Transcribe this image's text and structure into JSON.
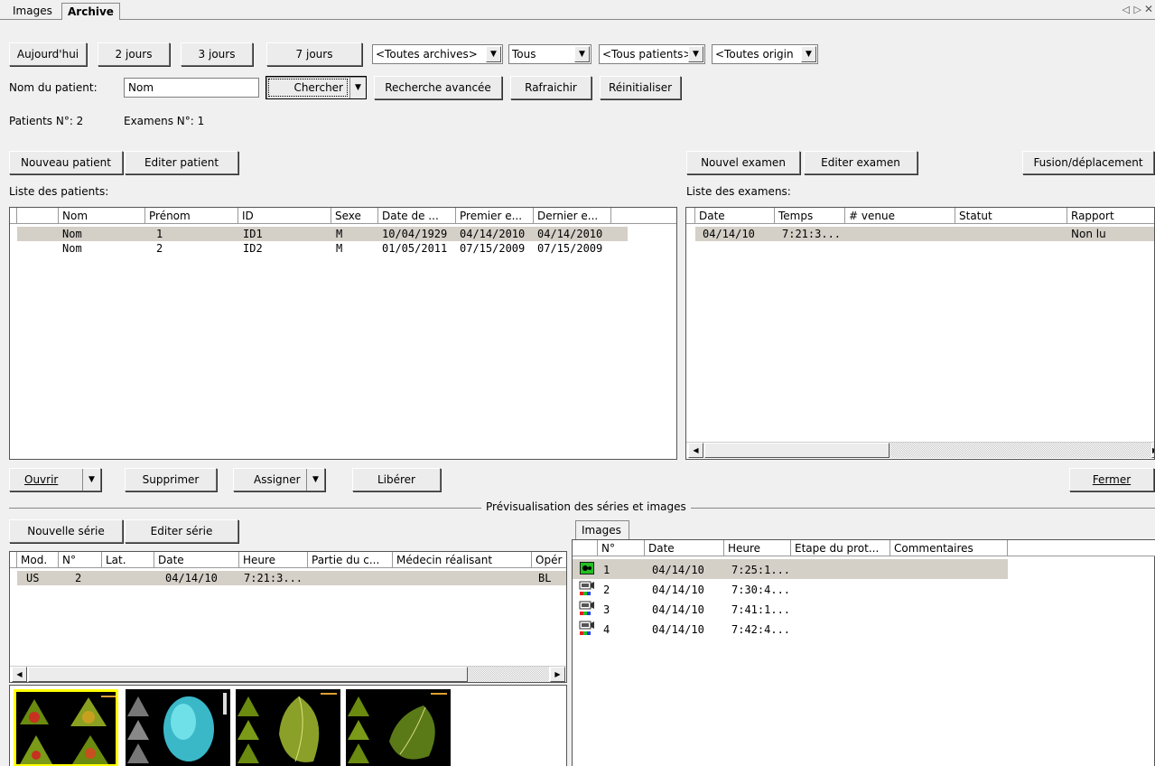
{
  "tabs": {
    "items": [
      "Images",
      "Archive"
    ],
    "active": "Archive",
    "nav_icons": [
      "prev-arrow-icon",
      "next-arrow-icon",
      "close-icon"
    ]
  },
  "filters": {
    "today": "Aujourd'hui",
    "d2": "2 jours",
    "d3": "3 jours",
    "d7": "7 jours",
    "archives": "<Toutes archives>",
    "tous": "Tous",
    "patients": "<Tous patients>",
    "origin": "<Toutes origin"
  },
  "search": {
    "label": "Nom du patient:",
    "value": "Nom",
    "search_btn": "Chercher",
    "advanced": "Recherche avancée",
    "refresh": "Rafraichir",
    "reset": "Réinitialiser"
  },
  "counts": {
    "patients": "Patients N°: 2",
    "exams": "Examens N°: 1"
  },
  "patient_buttons": {
    "new": "Nouveau patient",
    "edit": "Editer patient"
  },
  "exam_buttons": {
    "new": "Nouvel examen",
    "edit": "Editer examen",
    "merge": "Fusion/déplacement"
  },
  "patients": {
    "title": "Liste des patients:",
    "columns": [
      "Nom",
      "Prénom",
      "ID",
      "Sexe",
      "Date de ...",
      "Premier e...",
      "Dernier e..."
    ],
    "rows": [
      [
        "Nom",
        "1",
        "ID1",
        "M",
        "10/04/1929",
        "04/14/2010",
        "04/14/2010"
      ],
      [
        "Nom",
        "2",
        "ID2",
        "M",
        "01/05/2011",
        "07/15/2009",
        "07/15/2009"
      ]
    ]
  },
  "exams": {
    "title": "Liste des examens:",
    "columns": [
      "Date",
      "Temps",
      "# venue",
      "Statut",
      "Rapport"
    ],
    "rows": [
      [
        "04/14/10",
        "7:21:3...",
        "",
        "",
        "Non lu"
      ]
    ]
  },
  "actions": {
    "open": "Ouvrir",
    "delete": "Supprimer",
    "assign": "Assigner",
    "release": "Libérer",
    "close": "Fermer"
  },
  "preview": {
    "title": "Prévisualisation des séries et images"
  },
  "series_buttons": {
    "new": "Nouvelle série",
    "edit": "Editer série"
  },
  "series": {
    "columns": [
      "Mod.",
      "N°",
      "Lat.",
      "Date",
      "Heure",
      "Partie du c...",
      "Médecin réalisant",
      "Opér"
    ],
    "rows": [
      [
        "US",
        "2",
        "",
        "04/14/10",
        "7:21:3...",
        "",
        "",
        "BL"
      ]
    ]
  },
  "images": {
    "tab": "Images",
    "columns": [
      "N°",
      "Date",
      "Heure",
      "Etape du prot...",
      "Commentaires"
    ],
    "rows": [
      [
        "1",
        "04/14/10",
        "7:25:1..."
      ],
      [
        "2",
        "04/14/10",
        "7:30:4..."
      ],
      [
        "3",
        "04/14/10",
        "7:41:1..."
      ],
      [
        "4",
        "04/14/10",
        "7:42:4..."
      ]
    ]
  },
  "colors": {
    "selected_row": "#d4d0c8",
    "thumb_highlight": "#ffff00"
  }
}
